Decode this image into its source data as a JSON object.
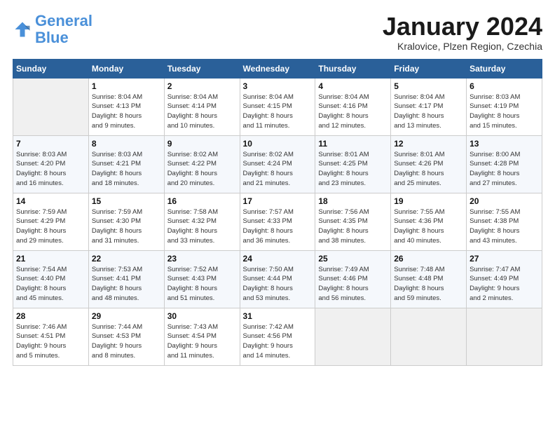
{
  "header": {
    "logo_line1": "General",
    "logo_line2": "Blue",
    "month": "January 2024",
    "location": "Kralovice, Plzen Region, Czechia"
  },
  "weekdays": [
    "Sunday",
    "Monday",
    "Tuesday",
    "Wednesday",
    "Thursday",
    "Friday",
    "Saturday"
  ],
  "weeks": [
    [
      {
        "day": "",
        "info": ""
      },
      {
        "day": "1",
        "info": "Sunrise: 8:04 AM\nSunset: 4:13 PM\nDaylight: 8 hours\nand 9 minutes."
      },
      {
        "day": "2",
        "info": "Sunrise: 8:04 AM\nSunset: 4:14 PM\nDaylight: 8 hours\nand 10 minutes."
      },
      {
        "day": "3",
        "info": "Sunrise: 8:04 AM\nSunset: 4:15 PM\nDaylight: 8 hours\nand 11 minutes."
      },
      {
        "day": "4",
        "info": "Sunrise: 8:04 AM\nSunset: 4:16 PM\nDaylight: 8 hours\nand 12 minutes."
      },
      {
        "day": "5",
        "info": "Sunrise: 8:04 AM\nSunset: 4:17 PM\nDaylight: 8 hours\nand 13 minutes."
      },
      {
        "day": "6",
        "info": "Sunrise: 8:03 AM\nSunset: 4:19 PM\nDaylight: 8 hours\nand 15 minutes."
      }
    ],
    [
      {
        "day": "7",
        "info": "Sunrise: 8:03 AM\nSunset: 4:20 PM\nDaylight: 8 hours\nand 16 minutes."
      },
      {
        "day": "8",
        "info": "Sunrise: 8:03 AM\nSunset: 4:21 PM\nDaylight: 8 hours\nand 18 minutes."
      },
      {
        "day": "9",
        "info": "Sunrise: 8:02 AM\nSunset: 4:22 PM\nDaylight: 8 hours\nand 20 minutes."
      },
      {
        "day": "10",
        "info": "Sunrise: 8:02 AM\nSunset: 4:24 PM\nDaylight: 8 hours\nand 21 minutes."
      },
      {
        "day": "11",
        "info": "Sunrise: 8:01 AM\nSunset: 4:25 PM\nDaylight: 8 hours\nand 23 minutes."
      },
      {
        "day": "12",
        "info": "Sunrise: 8:01 AM\nSunset: 4:26 PM\nDaylight: 8 hours\nand 25 minutes."
      },
      {
        "day": "13",
        "info": "Sunrise: 8:00 AM\nSunset: 4:28 PM\nDaylight: 8 hours\nand 27 minutes."
      }
    ],
    [
      {
        "day": "14",
        "info": "Sunrise: 7:59 AM\nSunset: 4:29 PM\nDaylight: 8 hours\nand 29 minutes."
      },
      {
        "day": "15",
        "info": "Sunrise: 7:59 AM\nSunset: 4:30 PM\nDaylight: 8 hours\nand 31 minutes."
      },
      {
        "day": "16",
        "info": "Sunrise: 7:58 AM\nSunset: 4:32 PM\nDaylight: 8 hours\nand 33 minutes."
      },
      {
        "day": "17",
        "info": "Sunrise: 7:57 AM\nSunset: 4:33 PM\nDaylight: 8 hours\nand 36 minutes."
      },
      {
        "day": "18",
        "info": "Sunrise: 7:56 AM\nSunset: 4:35 PM\nDaylight: 8 hours\nand 38 minutes."
      },
      {
        "day": "19",
        "info": "Sunrise: 7:55 AM\nSunset: 4:36 PM\nDaylight: 8 hours\nand 40 minutes."
      },
      {
        "day": "20",
        "info": "Sunrise: 7:55 AM\nSunset: 4:38 PM\nDaylight: 8 hours\nand 43 minutes."
      }
    ],
    [
      {
        "day": "21",
        "info": "Sunrise: 7:54 AM\nSunset: 4:40 PM\nDaylight: 8 hours\nand 45 minutes."
      },
      {
        "day": "22",
        "info": "Sunrise: 7:53 AM\nSunset: 4:41 PM\nDaylight: 8 hours\nand 48 minutes."
      },
      {
        "day": "23",
        "info": "Sunrise: 7:52 AM\nSunset: 4:43 PM\nDaylight: 8 hours\nand 51 minutes."
      },
      {
        "day": "24",
        "info": "Sunrise: 7:50 AM\nSunset: 4:44 PM\nDaylight: 8 hours\nand 53 minutes."
      },
      {
        "day": "25",
        "info": "Sunrise: 7:49 AM\nSunset: 4:46 PM\nDaylight: 8 hours\nand 56 minutes."
      },
      {
        "day": "26",
        "info": "Sunrise: 7:48 AM\nSunset: 4:48 PM\nDaylight: 8 hours\nand 59 minutes."
      },
      {
        "day": "27",
        "info": "Sunrise: 7:47 AM\nSunset: 4:49 PM\nDaylight: 9 hours\nand 2 minutes."
      }
    ],
    [
      {
        "day": "28",
        "info": "Sunrise: 7:46 AM\nSunset: 4:51 PM\nDaylight: 9 hours\nand 5 minutes."
      },
      {
        "day": "29",
        "info": "Sunrise: 7:44 AM\nSunset: 4:53 PM\nDaylight: 9 hours\nand 8 minutes."
      },
      {
        "day": "30",
        "info": "Sunrise: 7:43 AM\nSunset: 4:54 PM\nDaylight: 9 hours\nand 11 minutes."
      },
      {
        "day": "31",
        "info": "Sunrise: 7:42 AM\nSunset: 4:56 PM\nDaylight: 9 hours\nand 14 minutes."
      },
      {
        "day": "",
        "info": ""
      },
      {
        "day": "",
        "info": ""
      },
      {
        "day": "",
        "info": ""
      }
    ]
  ]
}
